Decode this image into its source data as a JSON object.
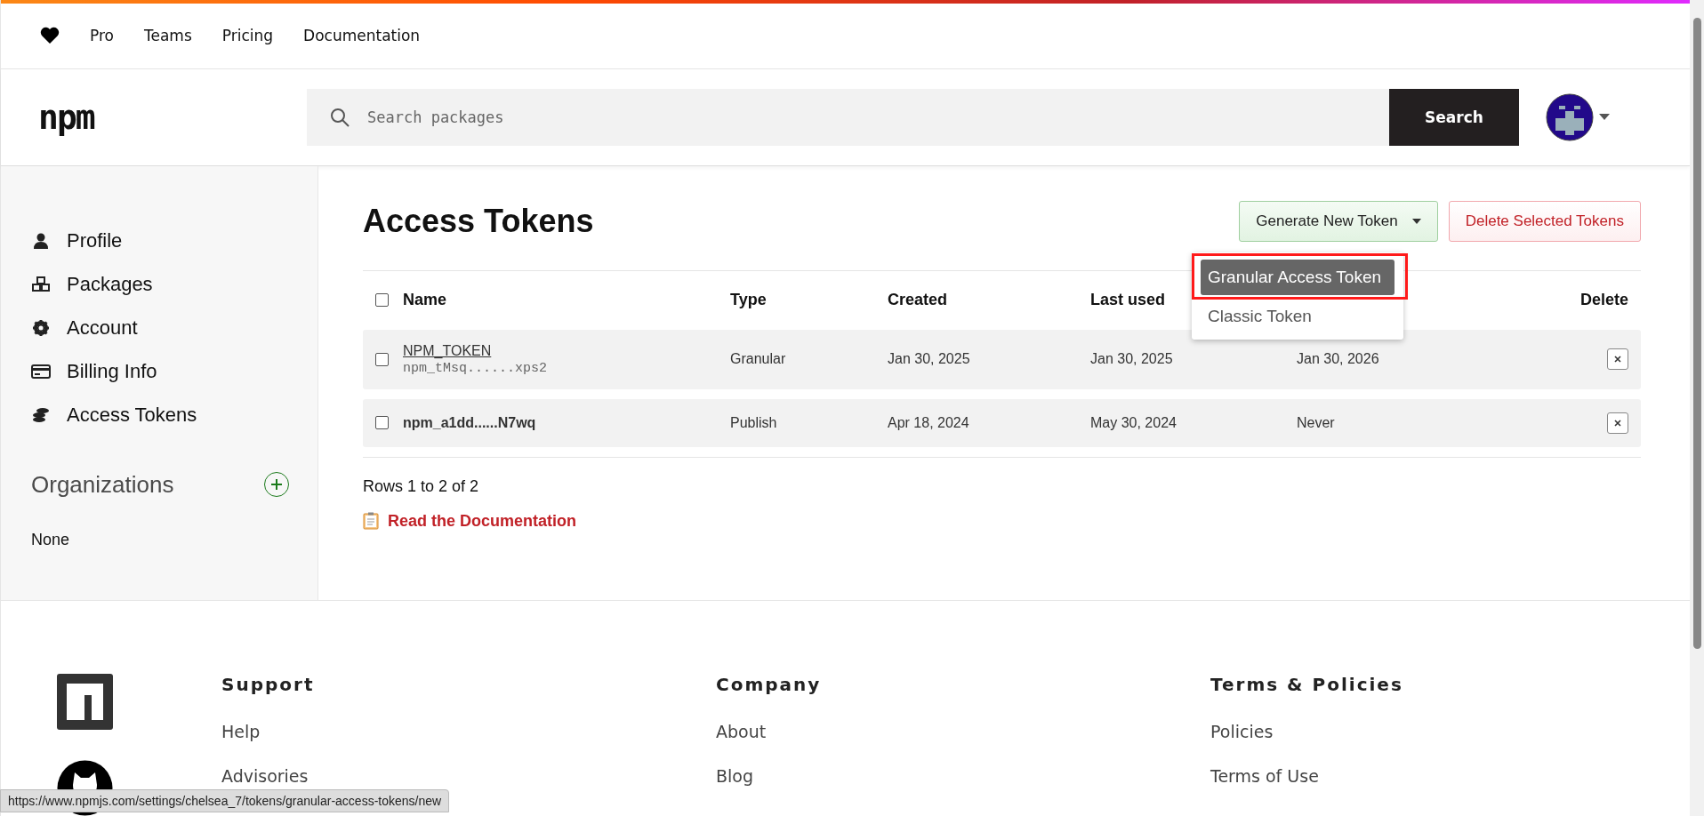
{
  "nav_links": [
    "Pro",
    "Teams",
    "Pricing",
    "Documentation"
  ],
  "logo": "npm",
  "search": {
    "placeholder": "Search packages",
    "button": "Search"
  },
  "sidebar": {
    "items": [
      {
        "label": "Profile",
        "kind": "person"
      },
      {
        "label": "Packages",
        "kind": "cubes"
      },
      {
        "label": "Account",
        "kind": "gear"
      },
      {
        "label": "Billing Info",
        "kind": "card"
      },
      {
        "label": "Access Tokens",
        "kind": "coins"
      }
    ],
    "organizations": {
      "title": "Organizations",
      "empty": "None"
    }
  },
  "page_title": "Access Tokens",
  "actions": {
    "generate": "Generate New Token",
    "delete_selected": "Delete Selected Tokens"
  },
  "generate_menu": {
    "expanded": true,
    "items": [
      {
        "label": "Granular Access Token",
        "selected": true
      },
      {
        "label": "Classic Token",
        "selected": false
      }
    ]
  },
  "table": {
    "columns": [
      "Name",
      "Type",
      "Created",
      "Last used",
      "Delete"
    ],
    "all_checked": false,
    "rows": [
      {
        "checked": false,
        "name": "NPM_TOKEN",
        "token": "npm_tMsq......xps2",
        "type": "Granular",
        "created": "Jan 30, 2025",
        "last_used": "Jan 30, 2025",
        "expires": "Jan 30, 2026"
      },
      {
        "checked": false,
        "name": "npm_a1dd......N7wq",
        "type": "Publish",
        "created": "Apr 18, 2024",
        "last_used": "May 30, 2024",
        "expires": "Never"
      }
    ]
  },
  "rows_info": "Rows 1 to 2 of 2",
  "doc_link": "Read the Documentation",
  "footer": {
    "columns": [
      {
        "title": "Support",
        "links": [
          "Help",
          "Advisories"
        ]
      },
      {
        "title": "Company",
        "links": [
          "About",
          "Blog"
        ]
      },
      {
        "title": "Terms & Policies",
        "links": [
          "Policies",
          "Terms of Use"
        ]
      }
    ]
  },
  "status_bar": {
    "url": "https://www.npmjs.com/settings/chelsea_7/tokens/granular-access-tokens/new"
  }
}
